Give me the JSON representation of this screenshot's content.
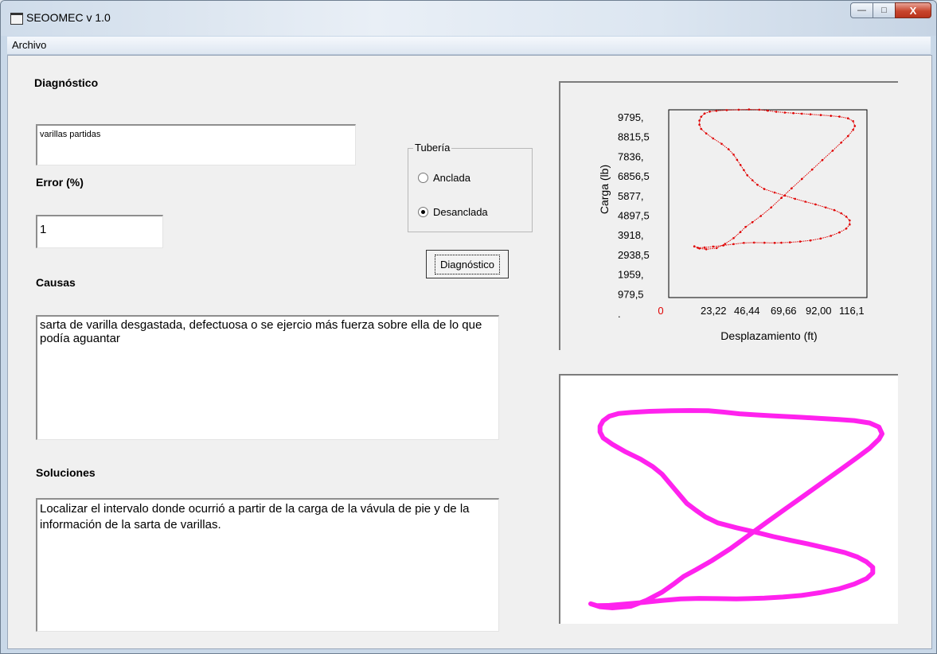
{
  "window": {
    "title": "SEOOMEC v 1.0"
  },
  "menu": {
    "archivo": "Archivo"
  },
  "caption_buttons": {
    "minimize": "—",
    "maximize": "□",
    "close": "X"
  },
  "diagnostico": {
    "label": "Diagnóstico",
    "value": "varillas partidas"
  },
  "error": {
    "label": "Error (%)",
    "value": "1"
  },
  "causas": {
    "label": "Causas",
    "value": "sarta de varilla desgastada, defectuosa o se ejercio más fuerza sobre ella de lo que podía aguantar"
  },
  "soluciones": {
    "label": "Soluciones",
    "value": "Localizar el intervalo donde ocurrió a partir de la carga de la vávula de pie y de la información de la sarta de varillas."
  },
  "tuberia": {
    "legend": "Tubería",
    "options": [
      {
        "label": "Anclada",
        "checked": false
      },
      {
        "label": "Desanclada",
        "checked": true
      }
    ]
  },
  "diagnostico_button": {
    "label": "Diagnóstico"
  },
  "colors": {
    "chart_series": "#e00000",
    "card_curve": "#ff22ee"
  },
  "chart_data": {
    "type": "line",
    "title": "",
    "xlabel": "Desplazamiento (ft)",
    "ylabel": "Carga (lb)",
    "y_ticks": [
      "9795,",
      "8815,5",
      "7836,",
      "6856,5",
      "5877,",
      "4897,5",
      "3918,",
      "2938,5",
      "1959,",
      "979,5",
      "."
    ],
    "x_ticks": [
      "0",
      "23,22",
      "46,44",
      "69,66",
      "92,00",
      "116,1"
    ],
    "xlim": [
      0,
      116.1
    ],
    "ylim": [
      0,
      9795
    ],
    "grid": false,
    "series": [
      {
        "x": [
          15,
          18,
          22,
          28,
          33,
          38,
          42,
          45,
          49,
          54,
          60,
          66,
          72,
          78,
          84,
          90,
          96,
          101,
          105,
          108,
          109,
          108,
          105,
          100,
          95,
          89,
          83,
          78,
          73,
          68,
          63,
          58,
          53,
          47,
          41,
          34,
          28,
          24,
          21,
          19,
          18,
          18,
          19,
          22,
          26,
          31,
          35,
          38,
          40,
          42,
          44,
          46,
          49,
          52,
          56,
          62,
          68,
          74,
          80,
          86,
          92,
          97,
          101,
          104,
          106,
          106,
          104,
          100,
          95,
          89,
          83,
          77,
          71,
          66,
          62,
          56,
          50,
          44,
          38,
          32,
          26,
          21,
          17,
          15
        ],
        "y": [
          2670,
          2560,
          2520,
          2580,
          2800,
          3100,
          3420,
          3680,
          3930,
          4260,
          4700,
          5200,
          5700,
          6190,
          6680,
          7170,
          7660,
          8080,
          8420,
          8750,
          8950,
          9200,
          9350,
          9440,
          9480,
          9520,
          9560,
          9590,
          9620,
          9650,
          9690,
          9750,
          9800,
          9810,
          9800,
          9780,
          9740,
          9700,
          9600,
          9430,
          9230,
          9020,
          8800,
          8560,
          8300,
          8020,
          7740,
          7460,
          7190,
          6920,
          6650,
          6380,
          6120,
          5880,
          5660,
          5480,
          5320,
          5150,
          5000,
          4860,
          4700,
          4560,
          4400,
          4220,
          4020,
          3810,
          3600,
          3400,
          3220,
          3080,
          2980,
          2920,
          2880,
          2860,
          2850,
          2860,
          2870,
          2850,
          2790,
          2720,
          2660,
          2610,
          2600,
          2670
        ]
      }
    ]
  }
}
